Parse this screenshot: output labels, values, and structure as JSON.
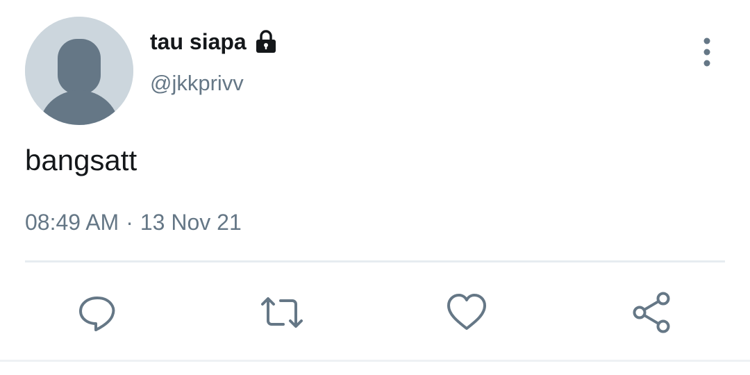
{
  "tweet": {
    "display_name": "tau siapa",
    "protected_icon": "lock-icon",
    "handle": "@jkkprivv",
    "text": "bangsatt",
    "time": "08:49 AM",
    "separator": "·",
    "date": "13 Nov 21",
    "more_icon": "more-vertical-icon"
  },
  "actions": [
    {
      "name": "reply",
      "icon": "comment-icon"
    },
    {
      "name": "retweet",
      "icon": "retweet-icon"
    },
    {
      "name": "like",
      "icon": "heart-icon"
    },
    {
      "name": "share",
      "icon": "share-icon"
    }
  ],
  "colors": {
    "text_primary": "#14171a",
    "text_secondary": "#657786",
    "avatar_bg": "#ccd6dd",
    "avatar_fg": "#657786",
    "divider": "#e6ecf0"
  }
}
